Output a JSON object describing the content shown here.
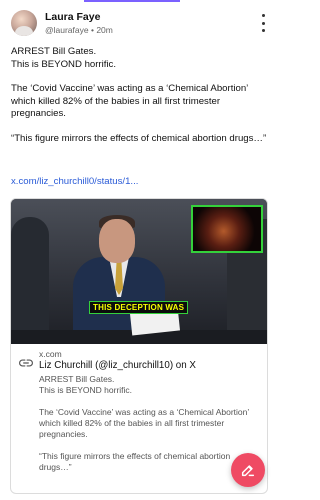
{
  "author": {
    "name": "Laura Faye",
    "handle": "@laurafaye",
    "time": "20m"
  },
  "post": {
    "line1": "ARREST Bill Gates.",
    "line2": "This is BEYOND horrific.",
    "para2": "The ‘Covid Vaccine’ was acting as a ‘Chemical Abortion’ which killed 82% of the babies in all first trimester pregnancies.",
    "para3": "“This figure mirrors the effects of chemical abortion drugs…”",
    "link": "x.com/liz_churchill0/status/1..."
  },
  "card": {
    "image_caption": "THIS DECEPTION WAS",
    "domain": "x.com",
    "title": "Liz Churchill (@liz_churchill10) on X",
    "desc_line1": "ARREST Bill Gates.",
    "desc_line2": "This is BEYOND horrific.",
    "desc_para2": "The ‘Covid Vaccine’ was acting as a ‘Chemical Abortion’ which killed 82% of the babies in all first trimester pregnancies.",
    "desc_para3": "“This figure mirrors the effects of chemical abortion drugs…”"
  },
  "icons": {
    "menu": "more-vertical-icon",
    "link": "link-icon",
    "compose": "edit-icon"
  },
  "colors": {
    "accent": "#7b61ff",
    "link": "#2a5bd7",
    "fab": "#ef4a63",
    "highlight_green": "#34d13b",
    "caption_yellow": "#f7ff00"
  }
}
